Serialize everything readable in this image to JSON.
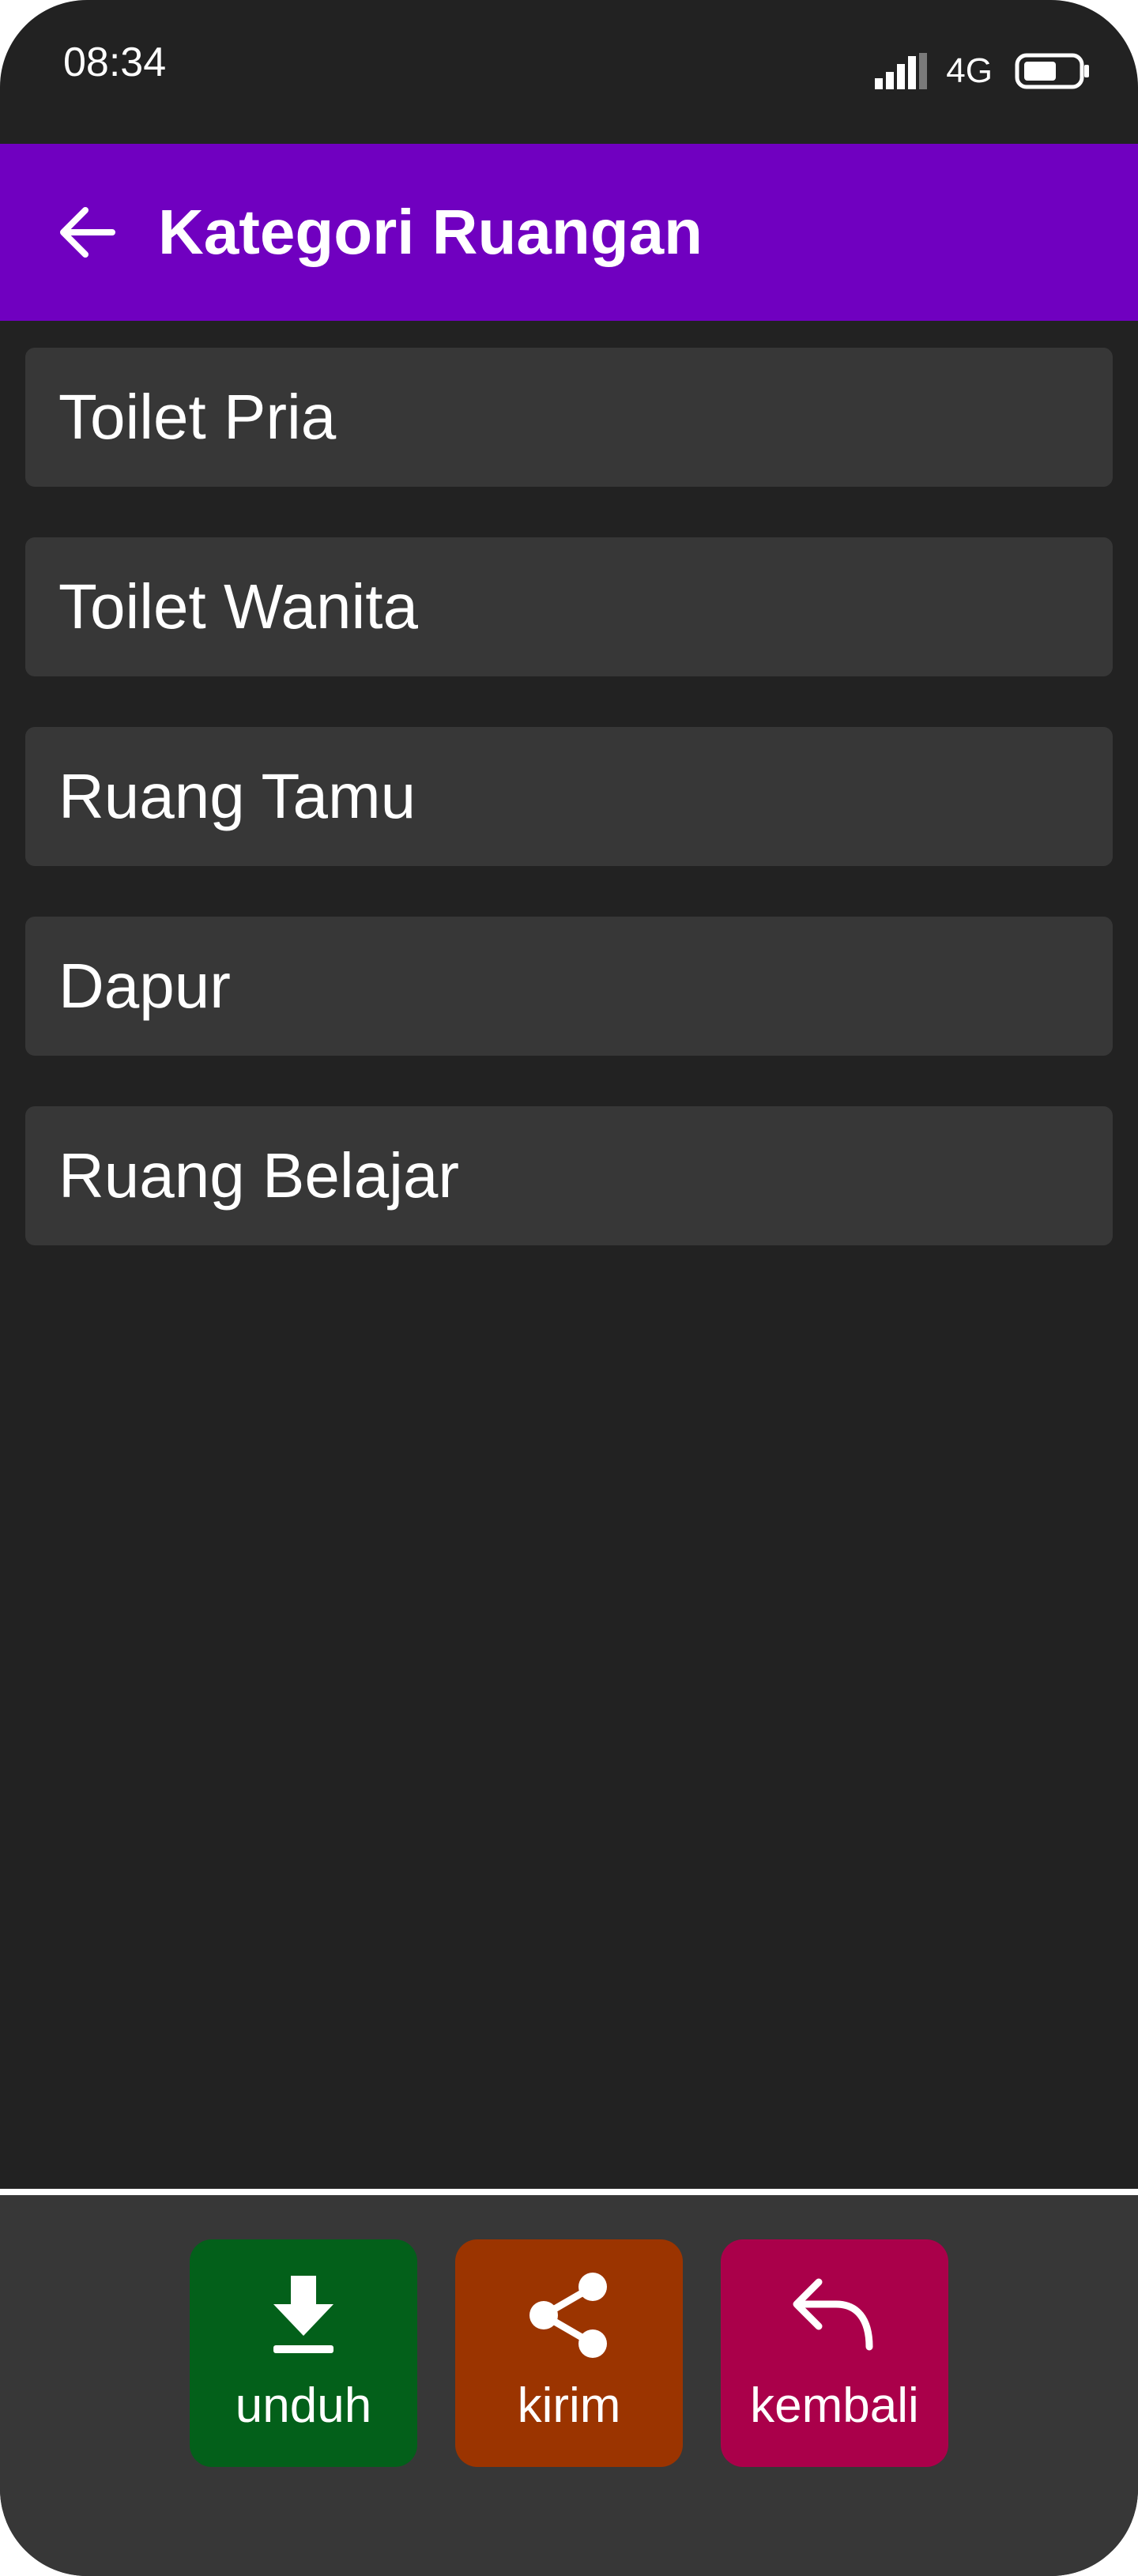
{
  "status_bar": {
    "time": "08:34",
    "network": "4G",
    "icons": [
      "signal-icon",
      "battery-icon"
    ]
  },
  "app_bar": {
    "title": "Kategori Ruangan",
    "back_icon": "arrow-left-icon",
    "color": "#7000c0"
  },
  "categories": [
    {
      "label": "Toilet Pria"
    },
    {
      "label": "Toilet Wanita"
    },
    {
      "label": "Ruang Tamu"
    },
    {
      "label": "Dapur"
    },
    {
      "label": "Ruang Belajar"
    }
  ],
  "bottom_actions": [
    {
      "label": "unduh",
      "icon": "download-icon",
      "color": "#03601a"
    },
    {
      "label": "kirim",
      "icon": "share-icon",
      "color": "#9b3400"
    },
    {
      "label": "kembali",
      "icon": "reply-icon",
      "color": "#aa004a"
    }
  ],
  "colors": {
    "background": "#222222",
    "card": "#373737",
    "text": "#ffffff"
  }
}
